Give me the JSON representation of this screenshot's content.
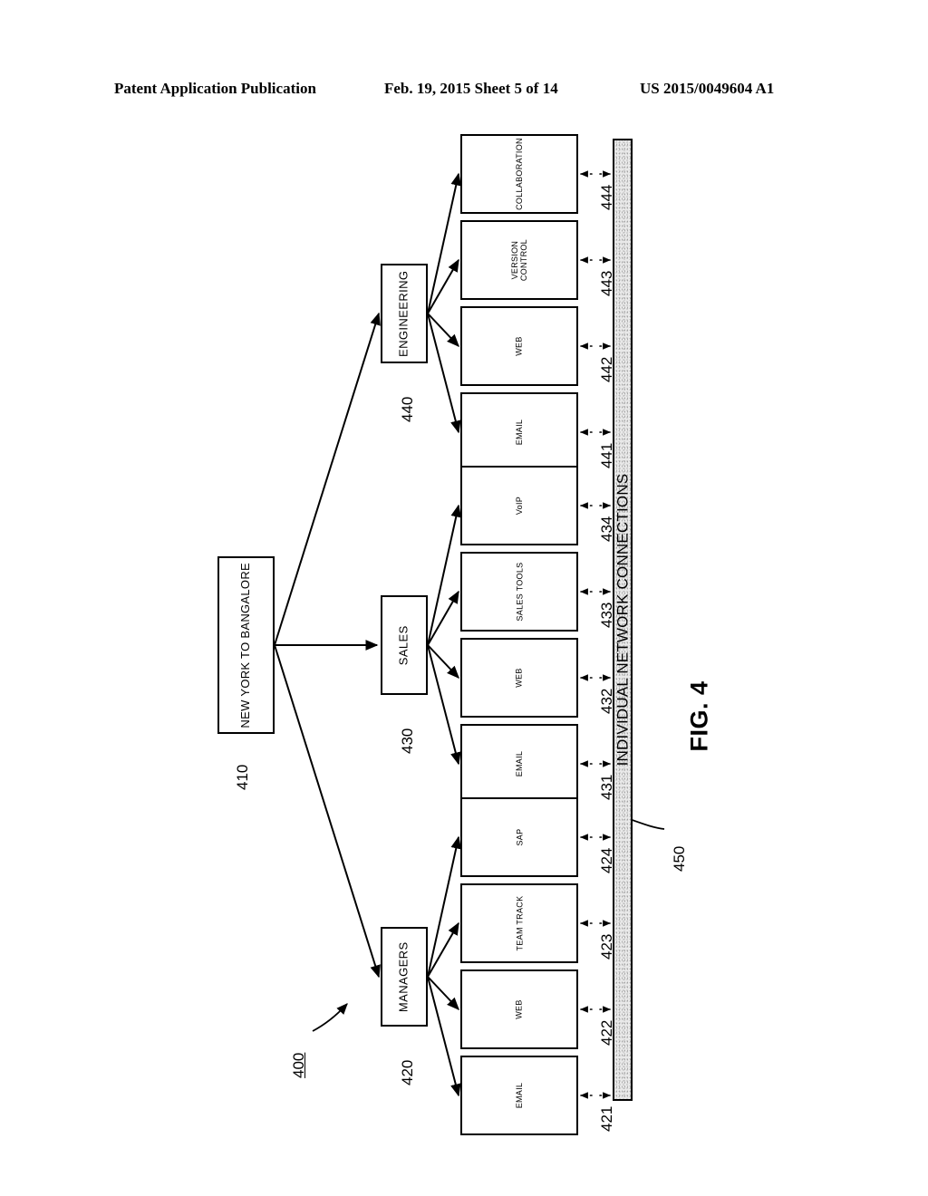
{
  "header": {
    "publication": "Patent Application Publication",
    "date_sheet": "Feb. 19, 2015  Sheet 5 of 14",
    "patent_number": "US 2015/0049604 A1"
  },
  "figure": {
    "caption": "FIG. 4",
    "diagram_ref": "400",
    "orientation_note": "rotated-90-ccw"
  },
  "diagram": {
    "source": {
      "label": "NEW YORK TO BANGALORE",
      "ref": "410"
    },
    "network_bar": {
      "label": "INDIVIDUAL NETWORK CONNECTIONS",
      "ref": "450"
    },
    "groups": [
      {
        "name": "managers-group",
        "label": "MANAGERS",
        "ref": "420",
        "applications": [
          {
            "label": "EMAIL",
            "ref": "421"
          },
          {
            "label": "WEB",
            "ref": "422"
          },
          {
            "label": "TEAM TRACK",
            "ref": "423"
          },
          {
            "label": "SAP",
            "ref": "424"
          }
        ]
      },
      {
        "name": "sales-group",
        "label": "SALES",
        "ref": "430",
        "applications": [
          {
            "label": "EMAIL",
            "ref": "431"
          },
          {
            "label": "WEB",
            "ref": "432"
          },
          {
            "label": "SALES TOOLS",
            "ref": "433"
          },
          {
            "label": "VoIP",
            "ref": "434"
          }
        ]
      },
      {
        "name": "engineering-group",
        "label": "ENGINEERING",
        "ref": "440",
        "applications": [
          {
            "label": "EMAIL",
            "ref": "441"
          },
          {
            "label": "WEB",
            "ref": "442"
          },
          {
            "label": "VERSION\nCONTROL",
            "ref": "443"
          },
          {
            "label": "COLLABORATION",
            "ref": "444"
          }
        ]
      }
    ]
  },
  "colors": {
    "ink": "#000000",
    "bar_fill": "#e9e9e9",
    "page": "#ffffff"
  }
}
